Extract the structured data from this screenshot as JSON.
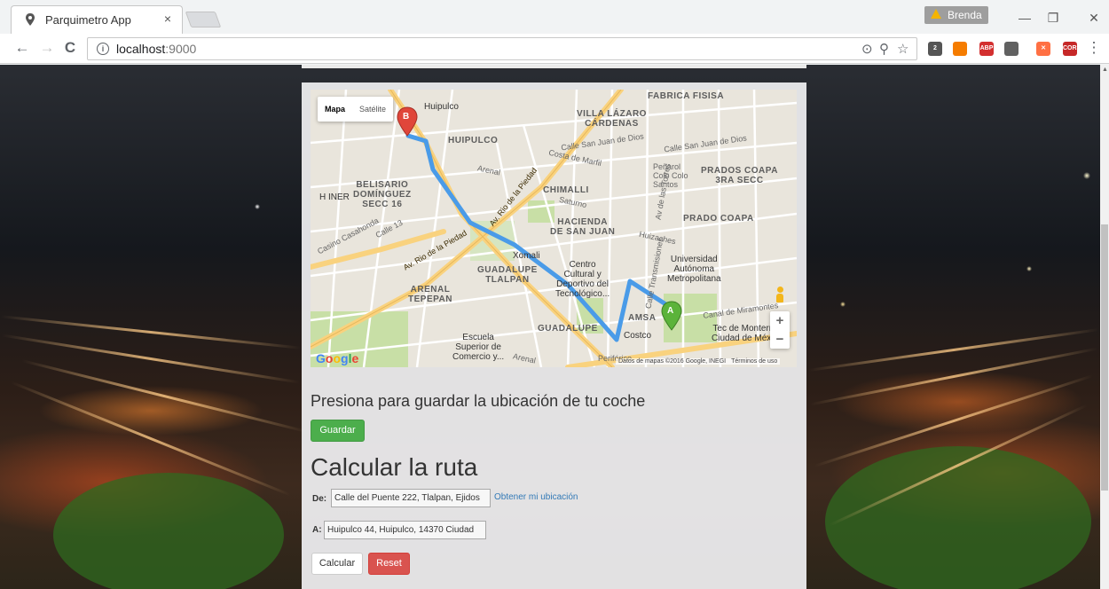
{
  "browser": {
    "tab": {
      "title": "Parquimetro App",
      "close_glyph": "×"
    },
    "profile": {
      "name": "Brenda"
    },
    "window": {
      "minimize_glyph": "—",
      "restore_glyph": "❐",
      "close_glyph": "✕"
    },
    "nav": {
      "back_glyph": "←",
      "forward_glyph": "→",
      "reload_glyph": "C"
    },
    "address": {
      "host": "localhost",
      "port": ":9000"
    },
    "omnibox_icons": {
      "location_glyph": "⊙",
      "zoom_glyph": "⚲",
      "star_glyph": "☆"
    },
    "extensions": [
      {
        "name": "ghostery-icon",
        "label": "2",
        "color": "#555555"
      },
      {
        "name": "fire-icon",
        "label": "",
        "color": "#f57c00"
      },
      {
        "name": "adblock-plus-icon",
        "label": "ABP",
        "color": "#d32f2f"
      },
      {
        "name": "extension-icon",
        "label": "",
        "color": "#616161"
      },
      {
        "name": "orange-x-icon",
        "label": "✕",
        "color": "#ff7043"
      },
      {
        "name": "cors-icon",
        "label": "CORS",
        "color": "#c62828"
      }
    ],
    "menu_glyph": "⋮"
  },
  "map": {
    "map_type": {
      "map": "Mapa",
      "satellite": "Satélite"
    },
    "labels": [
      {
        "text": "FABRICA FISISA",
        "class": "lbl-nb"
      },
      {
        "text": "VILLA LÁZARO\nCÁRDENAS",
        "class": "lbl-nb"
      },
      {
        "text": "HUIPULCO",
        "class": "lbl-nb"
      },
      {
        "text": "Huipulco",
        "class": "lbl-poi"
      },
      {
        "text": "Calle San Juan de Dios",
        "class": "lbl-st"
      },
      {
        "text": "Calle San Juan de Dios",
        "class": "lbl-st"
      },
      {
        "text": "Costa de Marfil",
        "class": "lbl-st"
      },
      {
        "text": "PRADOS COAPA\n3RA SECC",
        "class": "lbl-nb"
      },
      {
        "text": "Peñarol\nColo Colo\nSantos",
        "class": "lbl-st"
      },
      {
        "text": "BELISARIO\nDOMÍNGUEZ\nSECC 16",
        "class": "lbl-nb"
      },
      {
        "text": "H INER",
        "class": "lbl-poi"
      },
      {
        "text": "Arenal",
        "class": "lbl-st"
      },
      {
        "text": "CHIMALLI",
        "class": "lbl-nb"
      },
      {
        "text": "Saturno",
        "class": "lbl-st"
      },
      {
        "text": "PRADO COAPA",
        "class": "lbl-nb"
      },
      {
        "text": "HACIENDA\nDE SAN JUAN",
        "class": "lbl-nb"
      },
      {
        "text": "Huizaches",
        "class": "lbl-st"
      },
      {
        "text": "Calle 13",
        "class": "lbl-st"
      },
      {
        "text": "Casino Casahonda",
        "class": "lbl-st"
      },
      {
        "text": "Av. Rio de la Piedad",
        "class": "lbl-road"
      },
      {
        "text": "Av. Rio de la Piedad",
        "class": "lbl-road"
      },
      {
        "text": "Xomali",
        "class": "lbl-poi"
      },
      {
        "text": "Centro\nCultural y\nDeportivo del\nTecnológico...",
        "class": "lbl-poi"
      },
      {
        "text": "Universidad\nAutónoma\nMetropolitana",
        "class": "lbl-poi"
      },
      {
        "text": "GUADALUPE\nTLALPAN",
        "class": "lbl-nb"
      },
      {
        "text": "ARENAL\nTEPEPAN",
        "class": "lbl-nb"
      },
      {
        "text": "Av de las Torres",
        "class": "lbl-st"
      },
      {
        "text": "Calle Transmisiones",
        "class": "lbl-st"
      },
      {
        "text": "Canal de Miramontes",
        "class": "lbl-st"
      },
      {
        "text": "AMSA",
        "class": "lbl-nb"
      },
      {
        "text": "Tec de Monterrey\nCiudad de México",
        "class": "lbl-poi"
      },
      {
        "text": "Costco",
        "class": "lbl-poi"
      },
      {
        "text": "GUADALUPE",
        "class": "lbl-nb"
      },
      {
        "text": "Escuela\nSuperior de\nComercio y...",
        "class": "lbl-poi"
      },
      {
        "text": "Arenal",
        "class": "lbl-st"
      },
      {
        "text": "Periférico",
        "class": "lbl-st"
      }
    ],
    "markers": {
      "start": "A",
      "end": "B"
    },
    "zoom": {
      "in": "+",
      "out": "−"
    },
    "logo": {
      "g1": "G",
      "o1": "o",
      "o2": "o",
      "g2": "g",
      "l": "l",
      "e": "e"
    },
    "attribution": {
      "data": "Datos de mapas ©2016 Google, INEGI",
      "terms": "Términos de uso"
    },
    "colors": {
      "route": "#4a9be8",
      "park": "#c8dfa6",
      "road": "#ffffff",
      "highway": "#f9d27e"
    }
  },
  "form": {
    "save_heading": "Presiona para guardar la ubicación de tu coche",
    "save_button": "Guardar",
    "route_heading": "Calcular la ruta",
    "from_label": "De:",
    "from_value": "Calle del Puente 222, Tlalpan, Ejidos",
    "get_location_link": "Obtener mi ubicación",
    "to_label": "A:",
    "to_value": "Huipulco 44, Huipulco, 14370 Ciudad",
    "calculate_button": "Calcular",
    "reset_button": "Reset"
  }
}
